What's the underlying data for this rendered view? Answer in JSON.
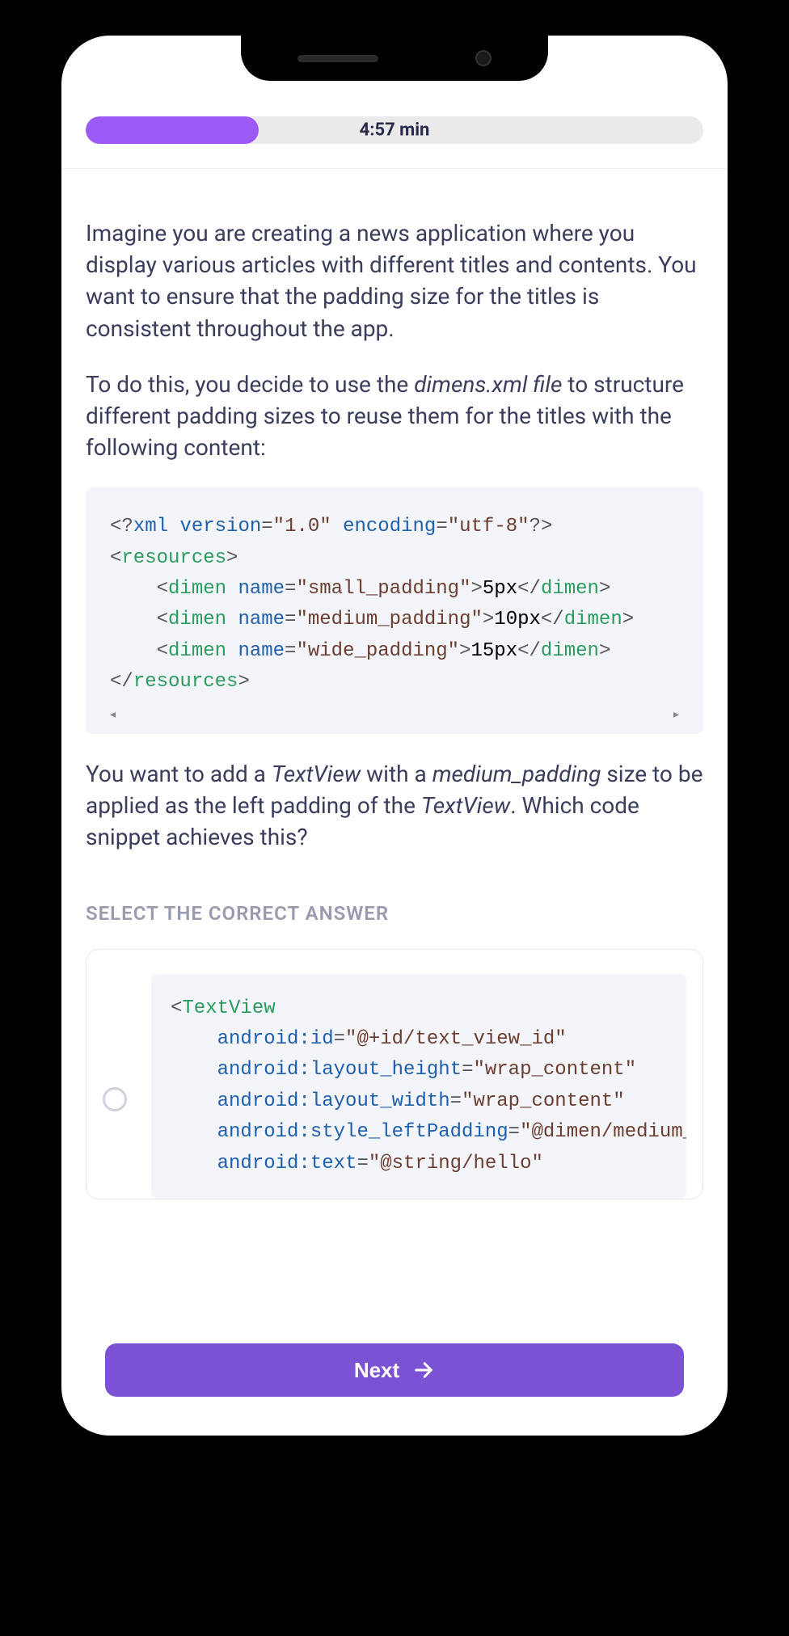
{
  "header": {
    "timer": "4:57 min",
    "progress_percent": 28
  },
  "question": {
    "p1": "Imagine you are creating a news application where you display various articles with different titles and contents. You want to ensure that the padding size for the titles is consistent throughout the app.",
    "p2_a": "To do this, you decide to use the ",
    "p2_italic": "dimens.xml file",
    "p2_b": " to structure different padding sizes to reuse them for the titles with the following content:",
    "p3_a": "You want to add a ",
    "p3_i1": "TextView",
    "p3_b": " with a ",
    "p3_i2": "medium_padding",
    "p3_c": " size to be applied as the left padding of the ",
    "p3_i3": "TextView",
    "p3_d": ". Which code snippet achieves this?"
  },
  "code1": {
    "xml_decl_version_attr": "version",
    "xml_decl_version_val": "\"1.0\"",
    "xml_decl_encoding_attr": "encoding",
    "xml_decl_encoding_val": "\"utf-8\"",
    "resources_tag": "resources",
    "dimen_tag": "dimen",
    "name_attr": "name",
    "d1_name": "\"small_padding\"",
    "d1_val": "5px",
    "d2_name": "\"medium_padding\"",
    "d2_val": "10px",
    "d3_name": "\"wide_padding\"",
    "d3_val": "15px"
  },
  "answers": {
    "label": "SELECT THE CORRECT ANSWER",
    "opt1": {
      "textview_tag": "TextView",
      "a1_name": "android:id",
      "a1_val": "\"@+id/text_view_id\"",
      "a2_name": "android:layout_height",
      "a2_val": "\"wrap_content\"",
      "a3_name": "android:layout_width",
      "a3_val": "\"wrap_content\"",
      "a4_name": "android:style_leftPadding",
      "a4_val": "\"@dimen/medium_padding\"",
      "a5_name": "android:text",
      "a5_val": "\"@string/hello\""
    }
  },
  "footer": {
    "next_label": "Next"
  }
}
